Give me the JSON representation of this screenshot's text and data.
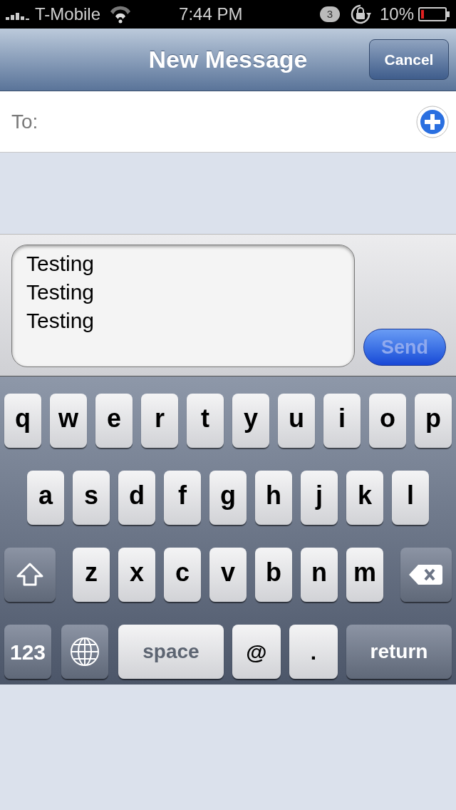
{
  "status_bar": {
    "carrier": "T-Mobile",
    "time": "7:44 PM",
    "badge": "3",
    "battery": "10%"
  },
  "nav_bar": {
    "title": "New Message",
    "cancel_button": "Cancel"
  },
  "to_field": {
    "label": "To:"
  },
  "compose": {
    "value": [
      "Testing",
      "Testing",
      "Testing"
    ],
    "send_button": {
      "label": "Send",
      "disabled": true
    }
  },
  "keyboard": {
    "rows": [
      {
        "keys": [
          {
            "kind": "letter",
            "label": "q"
          },
          {
            "kind": "letter",
            "label": "w"
          },
          {
            "kind": "letter",
            "label": "e"
          },
          {
            "kind": "letter",
            "label": "r"
          },
          {
            "kind": "letter",
            "label": "t"
          },
          {
            "kind": "letter",
            "label": "y"
          },
          {
            "kind": "letter",
            "label": "u"
          },
          {
            "kind": "letter",
            "label": "i"
          },
          {
            "kind": "letter",
            "label": "o"
          },
          {
            "kind": "letter",
            "label": "p"
          }
        ]
      },
      {
        "keys": [
          {
            "kind": "letter",
            "label": "a"
          },
          {
            "kind": "letter",
            "label": "s"
          },
          {
            "kind": "letter",
            "label": "d"
          },
          {
            "kind": "letter",
            "label": "f"
          },
          {
            "kind": "letter",
            "label": "g"
          },
          {
            "kind": "letter",
            "label": "h"
          },
          {
            "kind": "letter",
            "label": "j"
          },
          {
            "kind": "letter",
            "label": "k"
          },
          {
            "kind": "letter",
            "label": "l"
          }
        ]
      },
      {
        "keys": [
          {
            "kind": "shift"
          },
          {
            "kind": "letter",
            "label": "z"
          },
          {
            "kind": "letter",
            "label": "x"
          },
          {
            "kind": "letter",
            "label": "c"
          },
          {
            "kind": "letter",
            "label": "v"
          },
          {
            "kind": "letter",
            "label": "b"
          },
          {
            "kind": "letter",
            "label": "n"
          },
          {
            "kind": "letter",
            "label": "m"
          },
          {
            "kind": "backspace"
          }
        ]
      },
      {
        "keys": [
          {
            "kind": "mode",
            "label": "123"
          },
          {
            "kind": "globe"
          },
          {
            "kind": "space",
            "label": "space"
          },
          {
            "kind": "symbol",
            "label": "@"
          },
          {
            "kind": "symbol",
            "label": "."
          },
          {
            "kind": "return",
            "label": "return"
          }
        ]
      }
    ]
  }
}
